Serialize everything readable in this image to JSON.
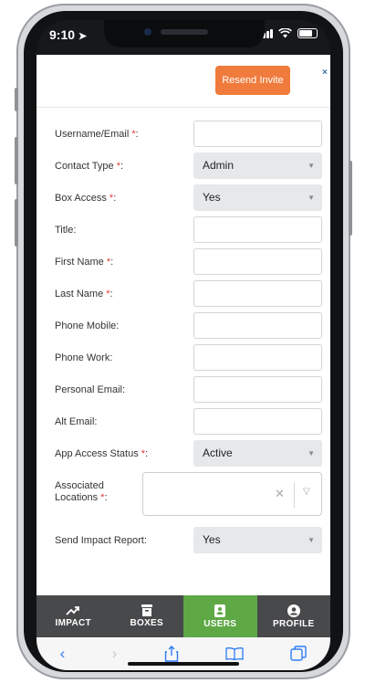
{
  "status_bar": {
    "time": "9:10"
  },
  "modal": {
    "resend_label": "Resend Invite",
    "close_label": "×"
  },
  "form": {
    "required_mark": "*",
    "fields": [
      {
        "key": "username",
        "label": "Username/Email",
        "required": true,
        "type": "text",
        "value": ""
      },
      {
        "key": "contact_type",
        "label": "Contact Type",
        "required": true,
        "type": "select",
        "value": "Admin"
      },
      {
        "key": "box_access",
        "label": "Box Access",
        "required": true,
        "type": "select",
        "value": "Yes"
      },
      {
        "key": "title",
        "label": "Title:",
        "required": false,
        "type": "text",
        "value": ""
      },
      {
        "key": "first_name",
        "label": "First Name",
        "required": true,
        "type": "text",
        "value": ""
      },
      {
        "key": "last_name",
        "label": "Last Name",
        "required": true,
        "type": "text",
        "value": ""
      },
      {
        "key": "phone_mobile",
        "label": "Phone Mobile:",
        "required": false,
        "type": "text",
        "value": ""
      },
      {
        "key": "phone_work",
        "label": "Phone Work:",
        "required": false,
        "type": "text",
        "value": ""
      },
      {
        "key": "personal_email",
        "label": "Personal Email:",
        "required": false,
        "type": "text",
        "value": ""
      },
      {
        "key": "alt_email",
        "label": "Alt Email:",
        "required": false,
        "type": "text",
        "value": ""
      },
      {
        "key": "app_access_status",
        "label": "App Access Status",
        "required": true,
        "type": "select",
        "value": "Active"
      },
      {
        "key": "associated_locations",
        "label_line1": "Associated",
        "label_line2": "Locations",
        "required": true,
        "type": "multiselect",
        "value": ""
      },
      {
        "key": "send_impact_report",
        "label": "Send Impact Report:",
        "required": false,
        "type": "select",
        "value": "Yes"
      }
    ]
  },
  "tabs": [
    {
      "label": "IMPACT",
      "icon": "trend-icon",
      "active": false
    },
    {
      "label": "BOXES",
      "icon": "box-icon",
      "active": false
    },
    {
      "label": "USERS",
      "icon": "users-icon",
      "active": true
    },
    {
      "label": "PROFILE",
      "icon": "profile-icon",
      "active": false
    }
  ],
  "colors": {
    "accent_orange": "#f07b3c",
    "active_tab_green": "#5fa846",
    "tabbar_bg": "#48494b",
    "required_red": "#e53935"
  }
}
